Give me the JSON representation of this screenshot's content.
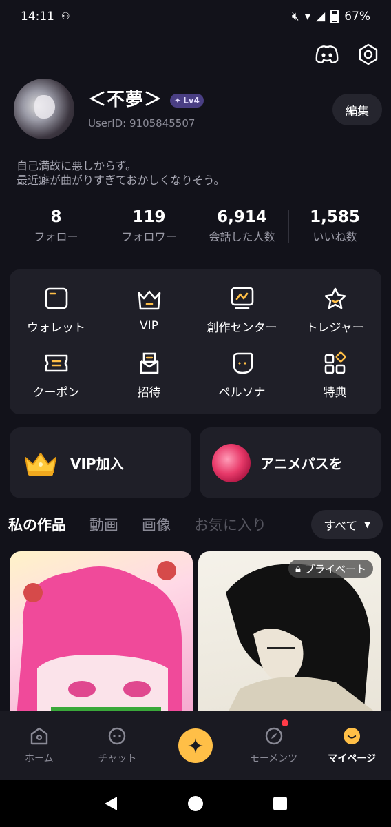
{
  "status": {
    "time": "14:11",
    "battery": "67%"
  },
  "profile": {
    "username": "＜不夢＞",
    "level": "Lv4",
    "user_id": "UserID: 9105845507",
    "edit_label": "編集",
    "bio_line1": "自己満故に悪しからず。",
    "bio_line2": "最近癖が曲がりすぎておかしくなりそう。"
  },
  "stats": [
    {
      "value": "8",
      "label": "フォロー"
    },
    {
      "value": "119",
      "label": "フォロワー"
    },
    {
      "value": "6,914",
      "label": "会話した人数"
    },
    {
      "value": "1,585",
      "label": "いいね数"
    }
  ],
  "menu": [
    {
      "label": "ウォレット",
      "icon": "wallet-icon"
    },
    {
      "label": "VIP",
      "icon": "crown-icon"
    },
    {
      "label": "創作センター",
      "icon": "creator-icon"
    },
    {
      "label": "トレジャー",
      "icon": "star-icon"
    },
    {
      "label": "クーポン",
      "icon": "coupon-icon"
    },
    {
      "label": "招待",
      "icon": "invite-icon"
    },
    {
      "label": "ペルソナ",
      "icon": "persona-icon"
    },
    {
      "label": "特典",
      "icon": "benefits-icon"
    }
  ],
  "promos": {
    "vip": "VIP加入",
    "anime": "アニメパスを"
  },
  "tabs": [
    "私の作品",
    "動画",
    "画像",
    "お気に入り"
  ],
  "filter_label": "すべて",
  "private_label": "プライベート",
  "nav": [
    {
      "label": "ホーム",
      "icon": "home-icon"
    },
    {
      "label": "チャット",
      "icon": "chat-icon"
    },
    {
      "label": "",
      "icon": "sparkle-icon"
    },
    {
      "label": "モーメンツ",
      "icon": "compass-icon"
    },
    {
      "label": "マイページ",
      "icon": "mypage-icon"
    }
  ],
  "colors": {
    "accent": "#ffbf47",
    "card": "#1f1f28",
    "background": "#12121a",
    "badge": "#4a3f84"
  }
}
